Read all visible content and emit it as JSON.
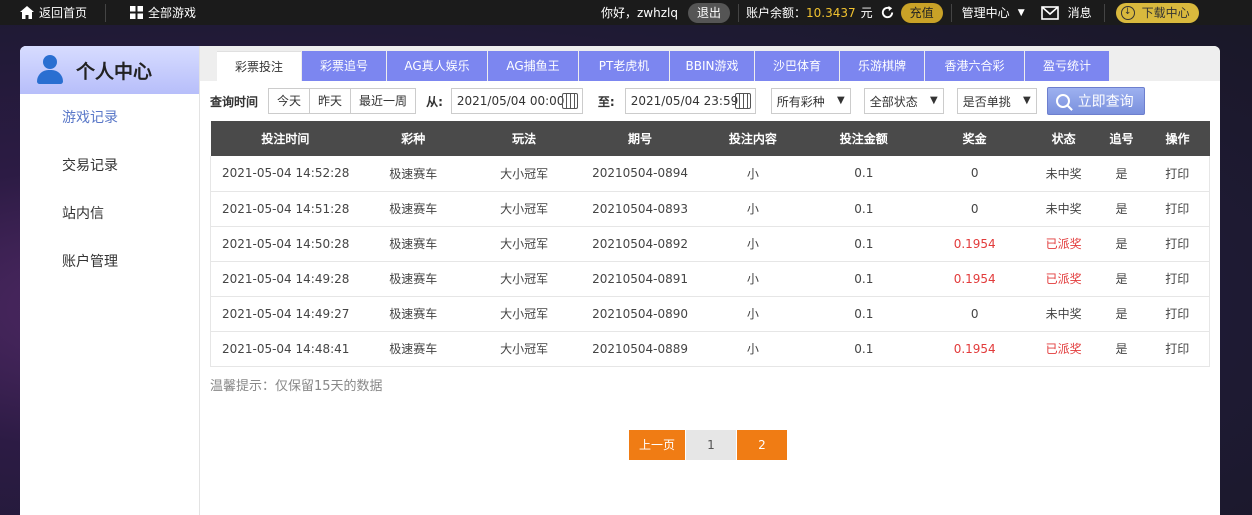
{
  "topbar": {
    "home_label": "返回首页",
    "all_games_label": "全部游戏",
    "greeting": "你好，zwhzlq",
    "logout_label": "退出",
    "balance_label": "账户余额：",
    "balance_value": "10.3437",
    "balance_unit": "元",
    "recharge_label": "充值",
    "manage_label": "管理中心",
    "message_label": "消息",
    "download_label": "下载中心"
  },
  "sidebar": {
    "title": "个人中心",
    "items": [
      {
        "label": "游戏记录"
      },
      {
        "label": "交易记录"
      },
      {
        "label": "站内信"
      },
      {
        "label": "账户管理"
      }
    ]
  },
  "tabs": [
    {
      "label": "彩票投注"
    },
    {
      "label": "彩票追号"
    },
    {
      "label": "AG真人娱乐"
    },
    {
      "label": "AG捕鱼王"
    },
    {
      "label": "PT老虎机"
    },
    {
      "label": "BBIN游戏"
    },
    {
      "label": "沙巴体育"
    },
    {
      "label": "乐游棋牌"
    },
    {
      "label": "香港六合彩"
    },
    {
      "label": "盈亏统计"
    }
  ],
  "filter": {
    "time_label": "查询时间",
    "quick": [
      "今天",
      "昨天",
      "最近一周"
    ],
    "from_label": "从:",
    "from_value": "2021/05/04 00:00",
    "to_label": "至:",
    "to_value": "2021/05/04 23:59",
    "lottery_select": "所有彩种",
    "status_select": "全部状态",
    "single_select": "是否单挑",
    "query_label": "立即查询"
  },
  "table": {
    "headers": [
      "投注时间",
      "彩种",
      "玩法",
      "期号",
      "投注内容",
      "投注金额",
      "奖金",
      "状态",
      "追号",
      "操作"
    ],
    "rows": [
      {
        "time": "2021-05-04 14:52:28",
        "lottery": "极速赛车",
        "play": "大小冠军",
        "issue": "20210504-0894",
        "content": "小",
        "amount": "0.1",
        "prize": "0",
        "status": "未中奖",
        "chase": "是",
        "action": "打印"
      },
      {
        "time": "2021-05-04 14:51:28",
        "lottery": "极速赛车",
        "play": "大小冠军",
        "issue": "20210504-0893",
        "content": "小",
        "amount": "0.1",
        "prize": "0",
        "status": "未中奖",
        "chase": "是",
        "action": "打印"
      },
      {
        "time": "2021-05-04 14:50:28",
        "lottery": "极速赛车",
        "play": "大小冠军",
        "issue": "20210504-0892",
        "content": "小",
        "amount": "0.1",
        "prize": "0.1954",
        "status": "已派奖",
        "chase": "是",
        "action": "打印"
      },
      {
        "time": "2021-05-04 14:49:28",
        "lottery": "极速赛车",
        "play": "大小冠军",
        "issue": "20210504-0891",
        "content": "小",
        "amount": "0.1",
        "prize": "0.1954",
        "status": "已派奖",
        "chase": "是",
        "action": "打印"
      },
      {
        "time": "2021-05-04 14:49:27",
        "lottery": "极速赛车",
        "play": "大小冠军",
        "issue": "20210504-0890",
        "content": "小",
        "amount": "0.1",
        "prize": "0",
        "status": "未中奖",
        "chase": "是",
        "action": "打印"
      },
      {
        "time": "2021-05-04 14:48:41",
        "lottery": "极速赛车",
        "play": "大小冠军",
        "issue": "20210504-0889",
        "content": "小",
        "amount": "0.1",
        "prize": "0.1954",
        "status": "已派奖",
        "chase": "是",
        "action": "打印"
      }
    ]
  },
  "tip": "温馨提示：仅保留15天的数据",
  "pager": {
    "prev_label": "上一页",
    "pages": [
      "1",
      "2"
    ]
  },
  "colors": {
    "accent": "#7c86f0",
    "win": "#e23b3b",
    "pager": "#f07c14"
  }
}
